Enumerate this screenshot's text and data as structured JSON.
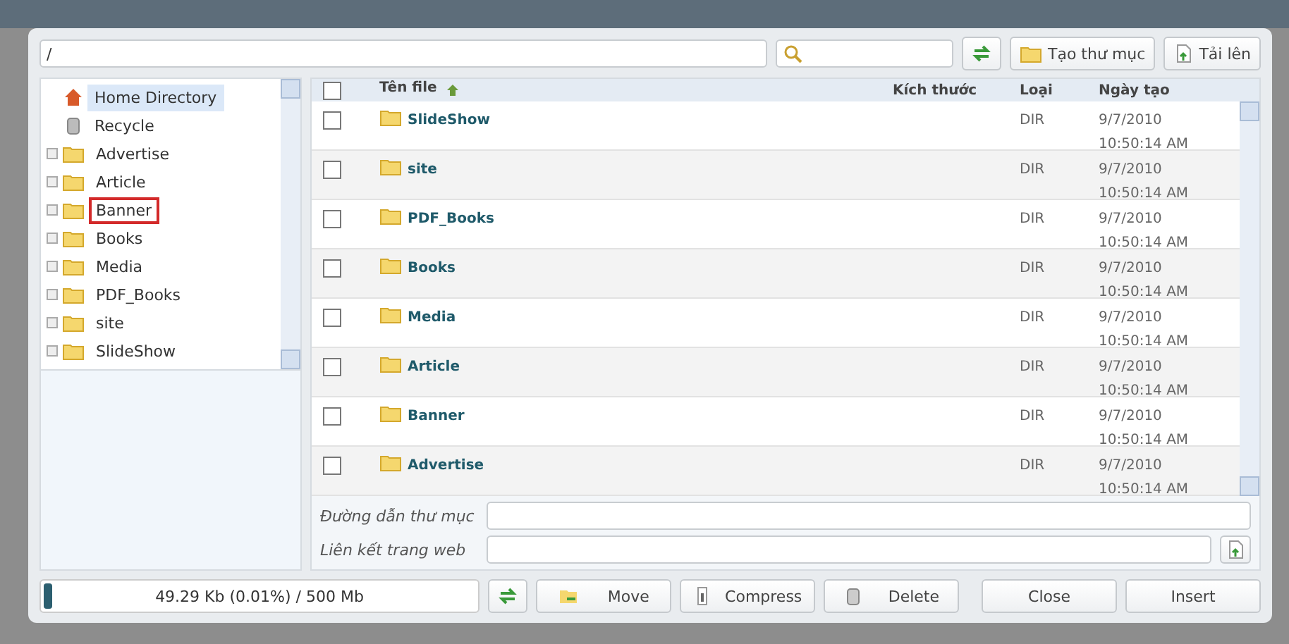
{
  "toolbar": {
    "path": "/",
    "buttons": [
      {
        "kind": "refresh"
      },
      {
        "kind": "new-folder",
        "label": "Tạo thư mục"
      },
      {
        "kind": "upload",
        "label": "Tải lên"
      }
    ]
  },
  "tree": {
    "items": [
      {
        "kind": "home",
        "label": "Home Directory",
        "selected": true,
        "marked": false
      },
      {
        "kind": "recycle",
        "label": "Recycle",
        "selected": false,
        "marked": false
      },
      {
        "kind": "folder",
        "label": "Advertise",
        "selected": false,
        "marked": false
      },
      {
        "kind": "folder",
        "label": "Article",
        "selected": false,
        "marked": false
      },
      {
        "kind": "folder",
        "label": "Banner",
        "selected": false,
        "marked": true
      },
      {
        "kind": "folder",
        "label": "Books",
        "selected": false,
        "marked": false
      },
      {
        "kind": "folder",
        "label": "Media",
        "selected": false,
        "marked": false
      },
      {
        "kind": "folder",
        "label": "PDF_Books",
        "selected": false,
        "marked": false
      },
      {
        "kind": "folder",
        "label": "site",
        "selected": false,
        "marked": false
      },
      {
        "kind": "folder",
        "label": "SlideShow",
        "selected": false,
        "marked": false
      }
    ]
  },
  "table": {
    "all_checked": false,
    "columns": [
      "Tên file",
      "Kích thước",
      "Loại",
      "Ngày tạo"
    ],
    "rows": [
      {
        "name": "SlideShow",
        "size": "",
        "type": "DIR",
        "date": "9/7/2010",
        "time": "10:50:14 AM",
        "checked": false
      },
      {
        "name": "site",
        "size": "",
        "type": "DIR",
        "date": "9/7/2010",
        "time": "10:50:14 AM",
        "checked": false
      },
      {
        "name": "PDF_Books",
        "size": "",
        "type": "DIR",
        "date": "9/7/2010",
        "time": "10:50:14 AM",
        "checked": false
      },
      {
        "name": "Books",
        "size": "",
        "type": "DIR",
        "date": "9/7/2010",
        "time": "10:50:14 AM",
        "checked": false
      },
      {
        "name": "Media",
        "size": "",
        "type": "DIR",
        "date": "9/7/2010",
        "time": "10:50:14 AM",
        "checked": false
      },
      {
        "name": "Article",
        "size": "",
        "type": "DIR",
        "date": "9/7/2010",
        "time": "10:50:14 AM",
        "checked": false
      },
      {
        "name": "Banner",
        "size": "",
        "type": "DIR",
        "date": "9/7/2010",
        "time": "10:50:14 AM",
        "checked": false
      },
      {
        "name": "Advertise",
        "size": "",
        "type": "DIR",
        "date": "9/7/2010",
        "time": "10:50:14 AM",
        "checked": false
      }
    ]
  },
  "fields": [
    {
      "label": "Đường dẫn thư mục",
      "kind": "plain"
    },
    {
      "label": "Liên kết trang web",
      "kind": "with-button"
    }
  ],
  "status": {
    "usage": "49.29 Kb (0.01%) / 500 Mb",
    "level": 0.02
  },
  "actions": [
    {
      "kind": "move",
      "label": "Move"
    },
    {
      "kind": "compress",
      "label": "Compress"
    },
    {
      "kind": "delete",
      "label": "Delete"
    },
    {
      "kind": "spacer"
    },
    {
      "kind": "plain",
      "label": "Close"
    },
    {
      "kind": "plain",
      "label": "Insert"
    }
  ]
}
